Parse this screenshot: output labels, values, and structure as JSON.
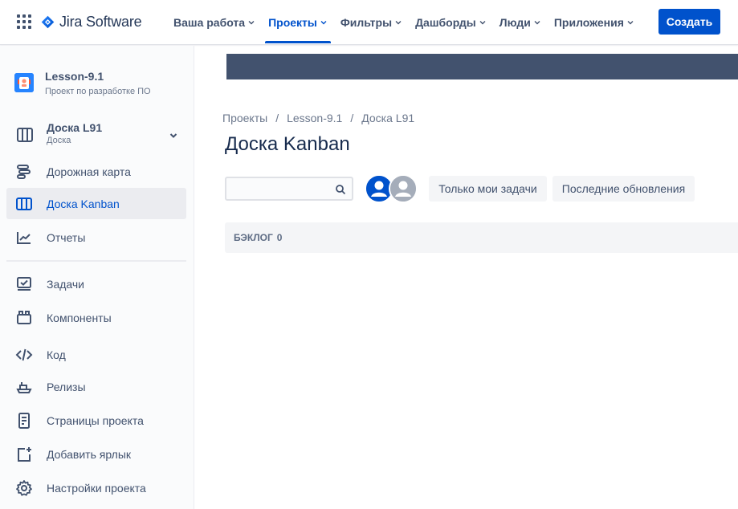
{
  "colors": {
    "brand": "#0052cc",
    "sidebar_bg": "#fafbfc",
    "banner": "#42526e",
    "text_primary": "#172b4d",
    "text_secondary": "#42526e"
  },
  "topbar": {
    "logo_text": "Jira Software",
    "nav": [
      {
        "label": "Ваша работа",
        "icon": "chevron-down-icon"
      },
      {
        "label": "Проекты",
        "icon": "chevron-down-icon"
      },
      {
        "label": "Фильтры",
        "icon": "chevron-down-icon"
      },
      {
        "label": "Дашборды",
        "icon": "chevron-down-icon"
      },
      {
        "label": "Люди",
        "icon": "chevron-down-icon"
      },
      {
        "label": "Приложения",
        "icon": "chevron-down-icon"
      }
    ],
    "active_nav": "Проекты",
    "create_label": "Создать"
  },
  "sidebar": {
    "project": {
      "name": "Lesson-9.1",
      "type": "Проект по разработке ПО"
    },
    "board": {
      "title": "Доска L91",
      "subtitle": "Доска"
    },
    "items": [
      {
        "label": "Дорожная карта",
        "icon": "roadmap-icon"
      },
      {
        "label": "Доска Kanban",
        "icon": "board-icon"
      },
      {
        "label": "Отчеты",
        "icon": "reports-icon"
      },
      {
        "label": "Задачи",
        "icon": "issues-icon"
      },
      {
        "label": "Компоненты",
        "icon": "components-icon"
      },
      {
        "label": "Код",
        "icon": "code-icon"
      },
      {
        "label": "Релизы",
        "icon": "releases-icon"
      },
      {
        "label": "Страницы проекта",
        "icon": "page-icon"
      },
      {
        "label": "Добавить ярлык",
        "icon": "add-shortcut-icon"
      },
      {
        "label": "Настройки проекта",
        "icon": "settings-icon"
      }
    ],
    "active_item": "Доска Kanban"
  },
  "main": {
    "breadcrumb": [
      "Проекты",
      "Lesson-9.1",
      "Доска L91"
    ],
    "breadcrumb_sep": "/",
    "title": "Доска Kanban",
    "search": {
      "value": "",
      "placeholder": ""
    },
    "filters": [
      "Только мои задачи",
      "Последние обновления"
    ],
    "column": {
      "name": "БЭКЛОГ",
      "count": "0"
    }
  }
}
